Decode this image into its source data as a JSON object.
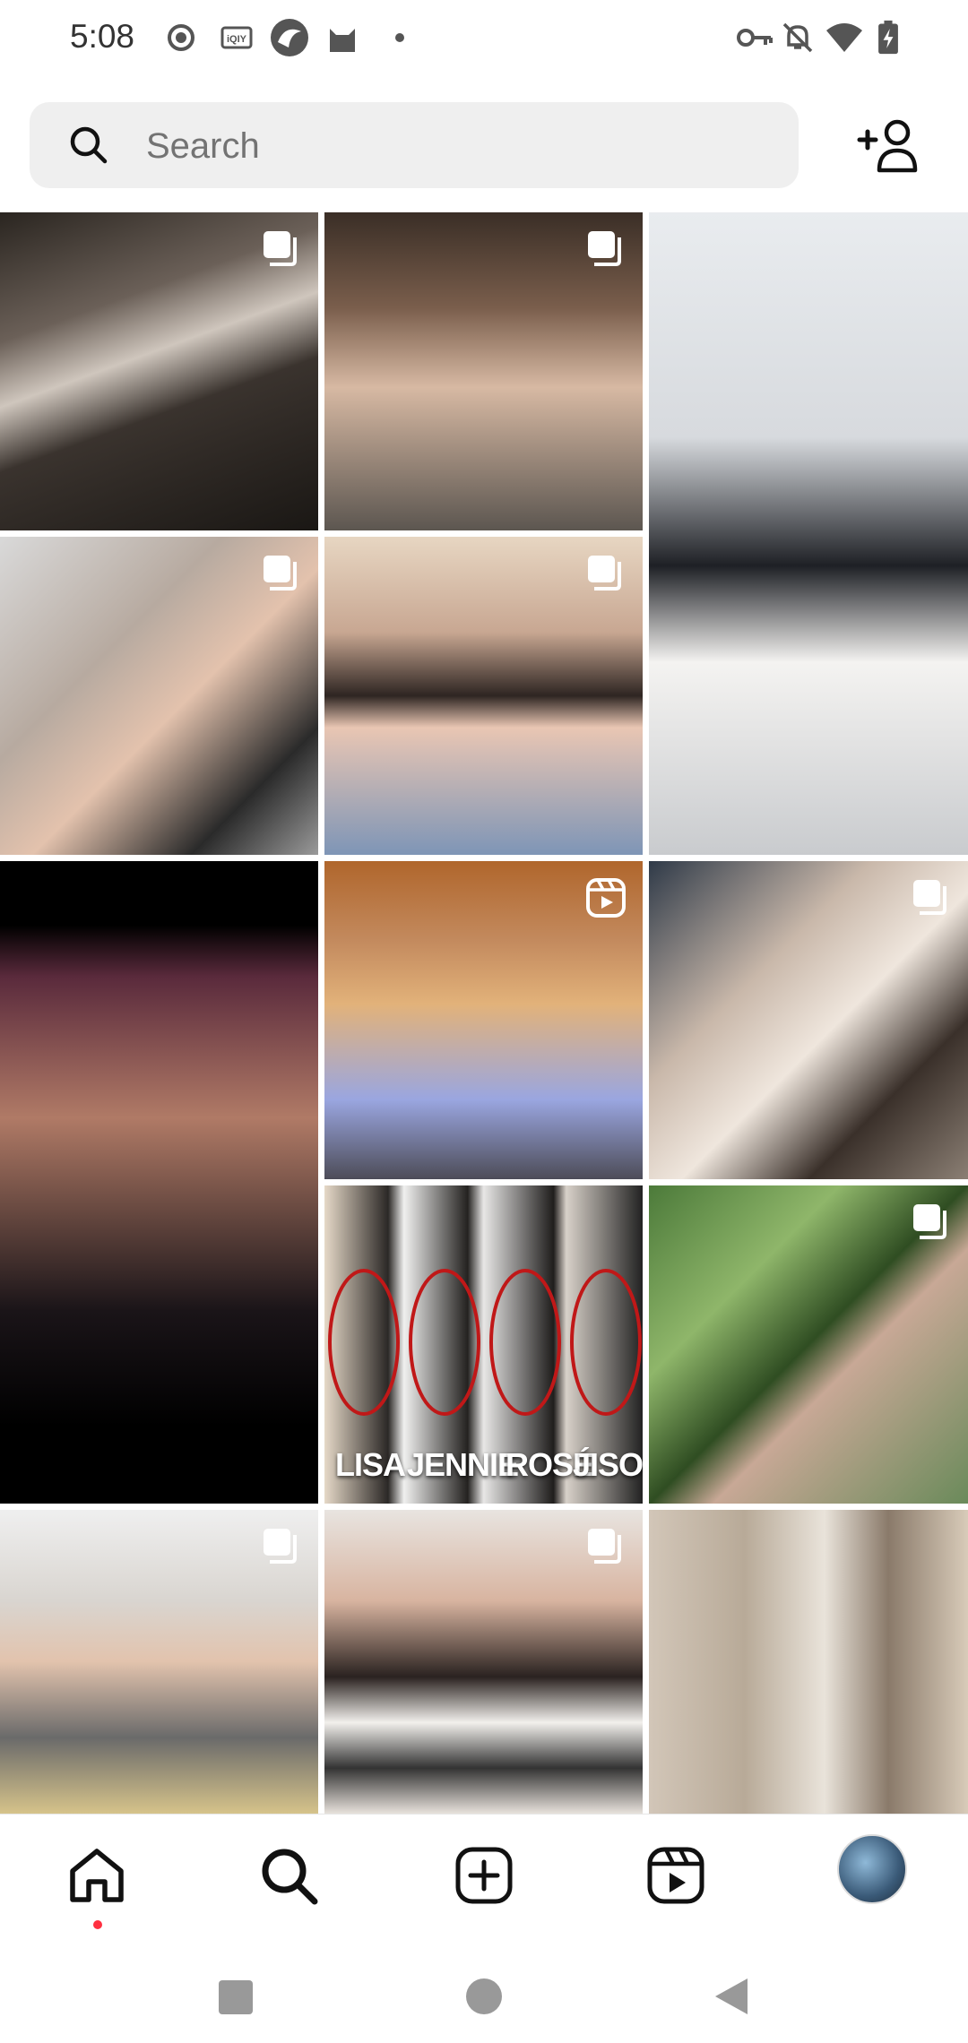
{
  "status_bar": {
    "time": "5:08",
    "left_icons": [
      "record-icon",
      "iqiyi-icon",
      "app-swirl-icon",
      "cat-icon",
      "dot-icon"
    ],
    "right_icons": [
      "vpn-key-icon",
      "bell-muted-icon",
      "wifi-icon",
      "battery-charging-icon"
    ]
  },
  "search": {
    "placeholder": "Search",
    "value": ""
  },
  "grid": {
    "tiles": [
      {
        "badge": "carousel-icon",
        "caption": ""
      },
      {
        "badge": "carousel-icon",
        "caption": ""
      },
      {
        "badge": "",
        "caption": ""
      },
      {
        "badge": "carousel-icon",
        "caption": ""
      },
      {
        "badge": "carousel-icon",
        "caption": ""
      },
      {
        "badge": "",
        "caption": ""
      },
      {
        "badge": "reels-icon",
        "caption": ""
      },
      {
        "badge": "carousel-icon",
        "caption": ""
      },
      {
        "badge": "",
        "caption": "",
        "labels": [
          "LISA",
          "JENNIE",
          "ROSÉ",
          "JISOO"
        ]
      },
      {
        "badge": "carousel-icon",
        "caption": ""
      },
      {
        "badge": "carousel-icon",
        "caption": ""
      },
      {
        "badge": "carousel-icon",
        "caption": ""
      },
      {
        "badge": "",
        "caption": ""
      }
    ]
  },
  "bottom_nav": {
    "items": [
      "home-icon",
      "search-icon",
      "create-icon",
      "reels-icon",
      "profile-avatar"
    ],
    "active": "home-icon",
    "notification_dot_color": "#ff3040"
  },
  "system_nav": [
    "recents-square-icon",
    "home-circle-icon",
    "back-triangle-icon"
  ]
}
